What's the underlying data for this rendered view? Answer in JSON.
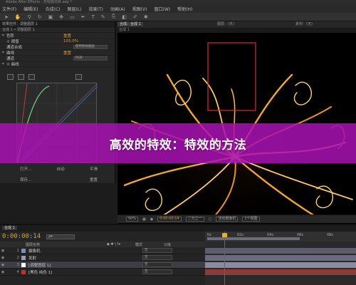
{
  "app": {
    "title": "Adobe After Effects - 无标题项目.aep *"
  },
  "menubar": {
    "items": [
      "文件(F)",
      "编辑(E)",
      "合成(C)",
      "图层(L)",
      "效果(T)",
      "动画(A)",
      "视图(V)",
      "窗口(W)",
      "帮助(H)"
    ]
  },
  "toolbar": {
    "tools": [
      "select-tool",
      "hand-tool",
      "zoom-tool",
      "rotate-tool",
      "camera-tool",
      "pan-tool",
      "mask-tool",
      "pen-tool",
      "text-tool",
      "brush-tool",
      "clone-tool",
      "eraser-tool",
      "roto-tool",
      "puppet-tool"
    ]
  },
  "effect_controls": {
    "tab": "效果控件：调整图层 1",
    "subheader": "合成 1 • 调整图层 1",
    "rows": [
      {
        "twirl": "▾",
        "name": "色阶",
        "value": "重置",
        "value_color": "orange"
      },
      {
        "twirl": "",
        "name": "☼ 阈值",
        "value": "103.0%",
        "value_color": "orange"
      },
      {
        "twirl": "",
        "name": "通道合成",
        "value": "",
        "control": "使用原始图层"
      },
      {
        "twirl": "▾",
        "name": "曲线",
        "value": "重置",
        "value_color": "orange"
      },
      {
        "twirl": "",
        "name": "通道",
        "value": "",
        "control": "RGB"
      },
      {
        "twirl": "▾",
        "name": "☼ 曲线",
        "value": "",
        "value_color": "orange"
      }
    ],
    "buttons_row1": [
      "打开...",
      "自动",
      "平滑"
    ],
    "buttons_row2": [
      "保存...",
      "",
      "重置"
    ]
  },
  "viewer": {
    "tabs": [
      "合成：合成 1",
      "图层：(无)",
      "素材：(无)"
    ],
    "active_tab": "合成：合成 1",
    "sub_tab": "合成 1",
    "controls": {
      "zoom": "50%",
      "timecode": "0:00:00:14",
      "resolution": "二分之一",
      "camera": "活动摄像机",
      "views": "1个视图"
    }
  },
  "banner": {
    "text": "高效的特效：特效的方法",
    "color": "#a812b2"
  },
  "timeline": {
    "tab": "合成 1",
    "timecode": "0:00:00:14",
    "search_placeholder": "ρ▾",
    "header": {
      "source_name": "图层名称",
      "mode": "模式",
      "parent": "父级"
    },
    "ruler_labels": [
      "0s",
      "02s",
      "04s",
      "06s",
      "08s",
      "10s"
    ],
    "layers": [
      {
        "num": "1",
        "name": "摄像机",
        "color": "#7f8fb0",
        "mode": "无",
        "selected": false
      },
      {
        "num": "2",
        "name": "发射",
        "color": "#9a9ab5",
        "mode": "无",
        "selected": false
      },
      {
        "num": "3",
        "name": "[调整图层 1]",
        "color": "#ffffff",
        "mode": "无",
        "selected": true
      },
      {
        "num": "4",
        "name": "[黑色 纯色 1]",
        "color": "#c23030",
        "mode": "无",
        "selected": false
      }
    ]
  }
}
